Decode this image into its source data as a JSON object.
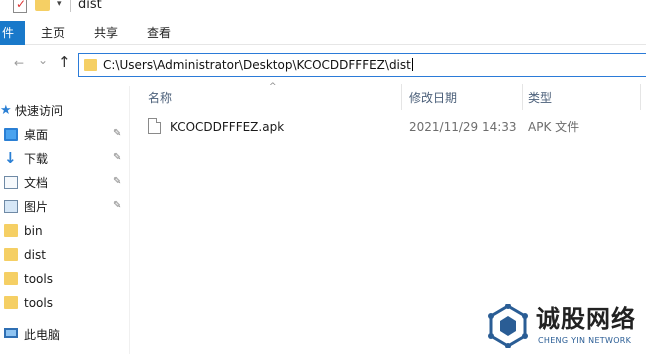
{
  "window": {
    "title": "dist",
    "qat_dropdown": "▾"
  },
  "ribbon": {
    "tabs": [
      {
        "label": "件"
      },
      {
        "label": "主页"
      },
      {
        "label": "共享"
      },
      {
        "label": "查看"
      }
    ]
  },
  "nav": {
    "back": "←",
    "forward": "→",
    "recent": "⌄",
    "up": "↑",
    "address": "C:\\Users\\Administrator\\Desktop\\KCOCDDFFFEZ\\dist"
  },
  "sidebar": {
    "items": [
      {
        "label": "快速访问",
        "icon": "star-icon",
        "pinned": false
      },
      {
        "label": "桌面",
        "icon": "desktop-icon",
        "pinned": true
      },
      {
        "label": "下载",
        "icon": "download-icon",
        "pinned": true
      },
      {
        "label": "文档",
        "icon": "document-icon",
        "pinned": true
      },
      {
        "label": "图片",
        "icon": "pictures-icon",
        "pinned": true
      },
      {
        "label": "bin",
        "icon": "folder-icon",
        "pinned": false
      },
      {
        "label": "dist",
        "icon": "folder-icon",
        "pinned": false
      },
      {
        "label": "tools",
        "icon": "folder-icon",
        "pinned": false
      },
      {
        "label": "tools",
        "icon": "folder-icon",
        "pinned": false
      },
      {
        "label": "此电脑",
        "icon": "computer-icon",
        "pinned": false
      }
    ],
    "pin_glyph": "📌"
  },
  "filelist": {
    "sort_arrow": "^",
    "columns": {
      "name": "名称",
      "date": "修改日期",
      "type": "类型"
    },
    "files": [
      {
        "name": "KCOCDDFFFEZ.apk",
        "date": "2021/11/29 14:33",
        "type": "APK 文件"
      }
    ]
  },
  "watermark": {
    "text": "诚股网络",
    "sub": "CHENG YIN NETWORK"
  },
  "colors": {
    "accent": "#1979ca",
    "address_border": "#2b7bd8",
    "folder": "#f5cf64"
  }
}
